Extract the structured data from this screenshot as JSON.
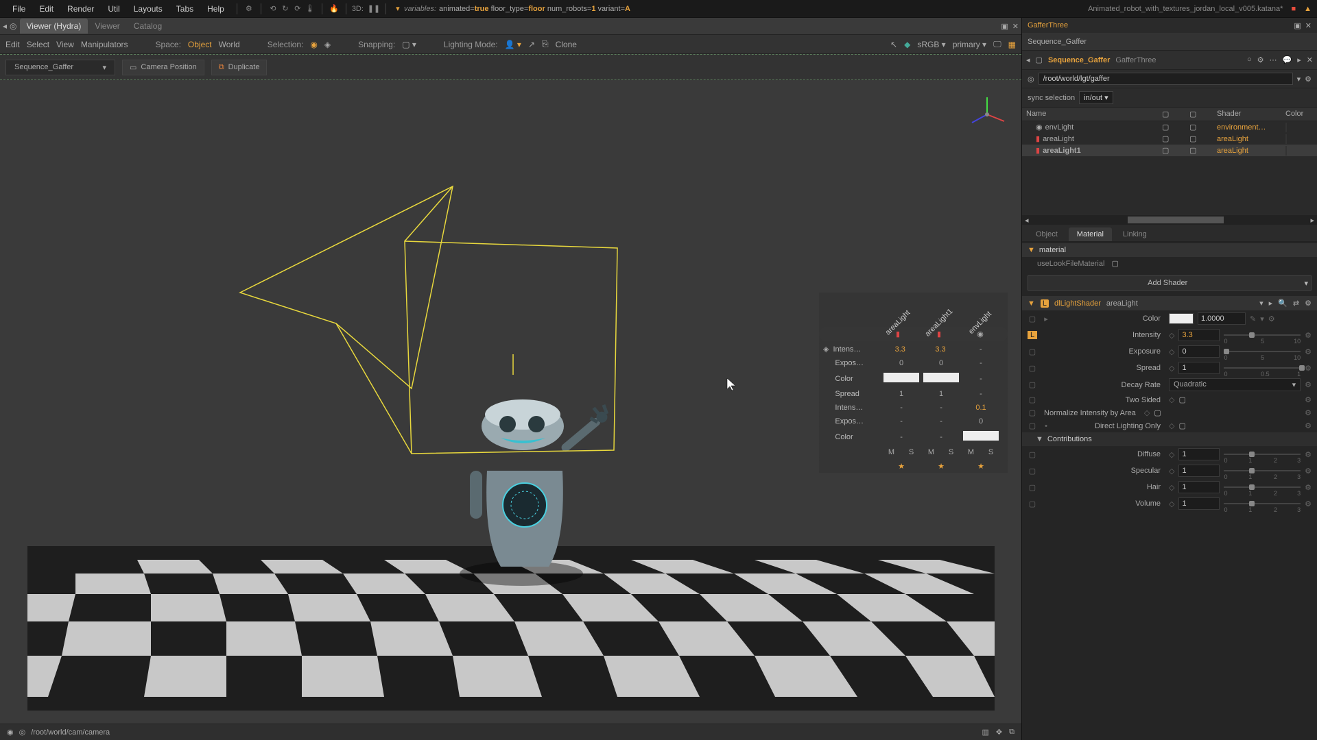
{
  "menubar": {
    "items": [
      "File",
      "Edit",
      "Render",
      "Util",
      "Layouts",
      "Tabs",
      "Help"
    ],
    "threed_label": "3D:",
    "variables_label": "variables:",
    "vars": [
      {
        "k": "animated",
        "v": "true"
      },
      {
        "k": "floor_type",
        "v": "floor"
      },
      {
        "k": "num_robots",
        "v": "1"
      },
      {
        "k": "variant",
        "v": "A"
      }
    ],
    "filename": "Animated_robot_with_textures_jordan_local_v005.katana*"
  },
  "left_tabs": [
    "Viewer (Hydra)",
    "Viewer",
    "Catalog"
  ],
  "viewer_toolbar": {
    "items": [
      "Edit",
      "Select",
      "View",
      "Manipulators"
    ],
    "space_label": "Space:",
    "space_options": [
      "Object",
      "World"
    ],
    "space_active": "Object",
    "selection_label": "Selection:",
    "snapping_label": "Snapping:",
    "lighting_label": "Lighting Mode:",
    "clone": "Clone",
    "colorspace": "sRGB",
    "view": "primary"
  },
  "scene_controls": {
    "dropdown": "Sequence_Gaffer",
    "cam_btn": "Camera Position",
    "dup_btn": "Duplicate"
  },
  "hud": {
    "columns": [
      "areaLight",
      "areaLight1",
      "envLight"
    ],
    "rows": [
      {
        "label": "Intens…",
        "vals": [
          "3.3",
          "3.3",
          "-"
        ],
        "changed": [
          true,
          true,
          false
        ]
      },
      {
        "label": "Expos…",
        "vals": [
          "0",
          "0",
          "-"
        ],
        "changed": [
          false,
          false,
          false
        ]
      },
      {
        "label": "Color",
        "vals": [
          "",
          "",
          "-"
        ],
        "swatch": [
          true,
          true,
          false
        ]
      },
      {
        "label": "Spread",
        "vals": [
          "1",
          "1",
          "-"
        ],
        "changed": [
          false,
          false,
          false
        ]
      },
      {
        "label": "Intens…",
        "vals": [
          "-",
          "-",
          "0.1"
        ],
        "changed": [
          false,
          false,
          true
        ]
      },
      {
        "label": "Expos…",
        "vals": [
          "-",
          "-",
          "0"
        ],
        "changed": [
          false,
          false,
          false
        ]
      },
      {
        "label": "Color",
        "vals": [
          "-",
          "-",
          ""
        ],
        "swatch": [
          false,
          false,
          true
        ]
      }
    ],
    "ms_row": [
      "M",
      "S",
      "M",
      "S",
      "M",
      "S"
    ]
  },
  "statusbar": {
    "path": "/root/world/cam/camera"
  },
  "right": {
    "node_type": "GafferThree",
    "node_name": "Sequence_Gaffer",
    "sub_name": "Sequence_Gaffer",
    "sub_type": "GafferThree",
    "root_path": "/root/world/lgt/gaffer",
    "sync_label": "sync selection",
    "sync_value": "in/out",
    "table_headers": [
      "Name",
      "",
      "",
      "Shader",
      "Color"
    ],
    "lights": [
      {
        "name": "envLight",
        "shader": "environment…"
      },
      {
        "name": "areaLight",
        "shader": "areaLight"
      },
      {
        "name": "areaLight1",
        "shader": "areaLight"
      }
    ],
    "prop_tabs": [
      "Object",
      "Material",
      "Linking"
    ],
    "material_section": "material",
    "use_lookfile": "useLookFileMaterial",
    "add_shader": "Add Shader",
    "shader_name": "dlLightShader",
    "shader_type": "areaLight",
    "shader_params": {
      "color": {
        "label": "Color",
        "value": "1.0000"
      },
      "intensity": {
        "label": "Intensity",
        "value": "3.3",
        "min": "0",
        "mid": "5",
        "max": "10"
      },
      "exposure": {
        "label": "Exposure",
        "value": "0",
        "min": "0",
        "mid": "5",
        "max": "10"
      },
      "spread": {
        "label": "Spread",
        "value": "1",
        "min": "0",
        "mid": "0.5",
        "max": "1"
      },
      "decay": {
        "label": "Decay Rate",
        "value": "Quadratic"
      },
      "twosided": {
        "label": "Two Sided"
      },
      "normalize": {
        "label": "Normalize Intensity by Area"
      },
      "directonly": {
        "label": "Direct Lighting Only"
      }
    },
    "contrib_section": "Contributions",
    "contribs": [
      {
        "label": "Diffuse",
        "value": "1",
        "min": "0",
        "mid1": "1",
        "mid2": "2",
        "max": "3"
      },
      {
        "label": "Specular",
        "value": "1",
        "min": "0",
        "mid1": "1",
        "mid2": "2",
        "max": "3"
      },
      {
        "label": "Hair",
        "value": "1",
        "min": "0",
        "mid1": "1",
        "mid2": "2",
        "max": "3"
      },
      {
        "label": "Volume",
        "value": "1",
        "min": "0",
        "mid1": "1",
        "mid2": "2",
        "max": "3"
      }
    ]
  }
}
